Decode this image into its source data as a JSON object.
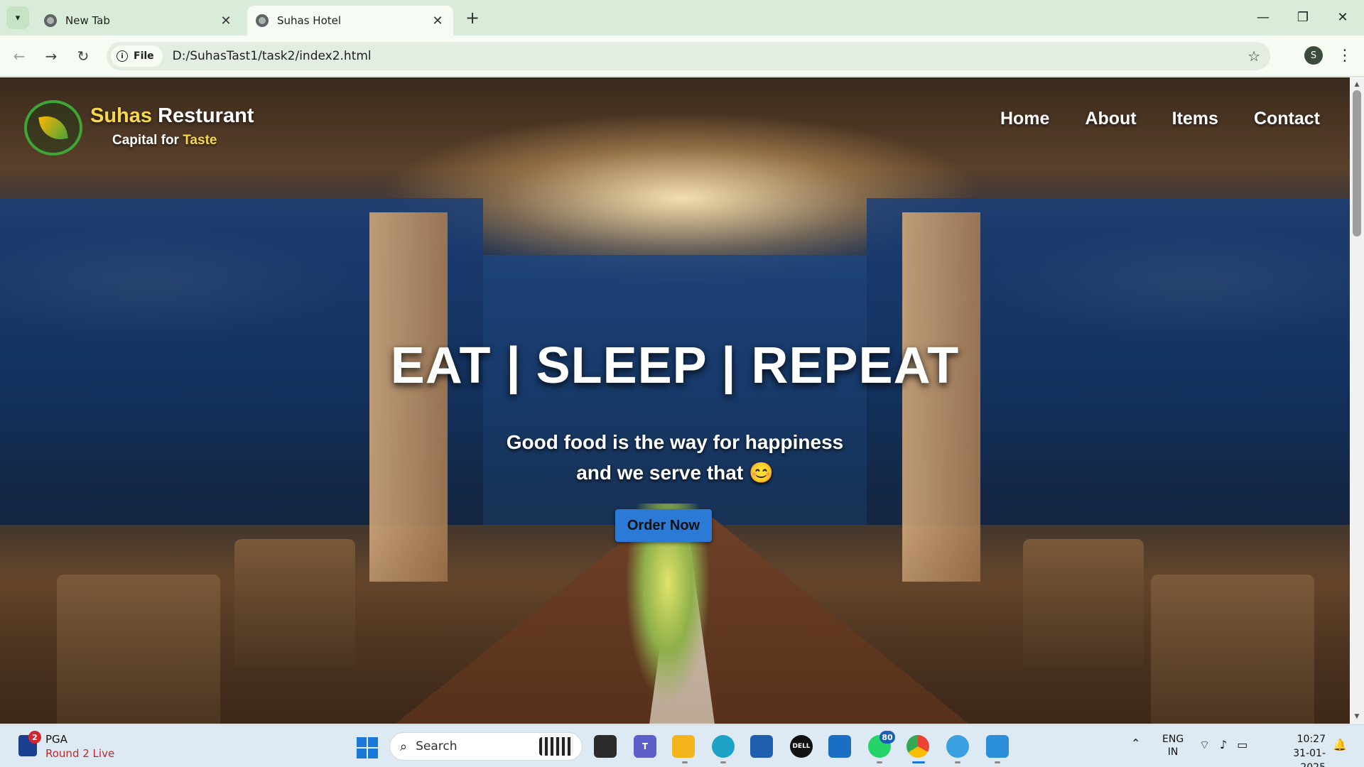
{
  "browser": {
    "tabs": [
      {
        "title": "New Tab",
        "active": false
      },
      {
        "title": "Suhas Hotel",
        "active": true
      }
    ],
    "new_tab_symbol": "+",
    "close_symbol": "✕",
    "address": {
      "chip_label": "File",
      "url": "D:/SuhasTast1/task2/index2.html"
    },
    "profile_initial": "S"
  },
  "site": {
    "brand": {
      "name_accent": "Suhas",
      "name_rest": " Resturant",
      "tag_prefix": "Capital for ",
      "tag_accent": "Taste"
    },
    "nav": [
      "Home",
      "About",
      "Items",
      "Contact"
    ],
    "hero": {
      "title": "EAT | SLEEP | REPEAT",
      "subtitle_line1": "Good food is the way for happiness",
      "subtitle_line2": "and we serve that 😊",
      "cta": "Order Now"
    },
    "colors": {
      "accent_yellow": "#f7d84a",
      "button_blue": "#2b7bd6",
      "logo_green": "#3fa535"
    }
  },
  "taskbar": {
    "widget": {
      "badge": "2",
      "title": "PGA",
      "subtitle": "Round 2 Live"
    },
    "search_label": "Search",
    "whatsapp_badge": "80",
    "language": {
      "line1": "ENG",
      "line2": "IN"
    },
    "clock": {
      "time": "10:27",
      "date": "31-01-2025"
    }
  }
}
